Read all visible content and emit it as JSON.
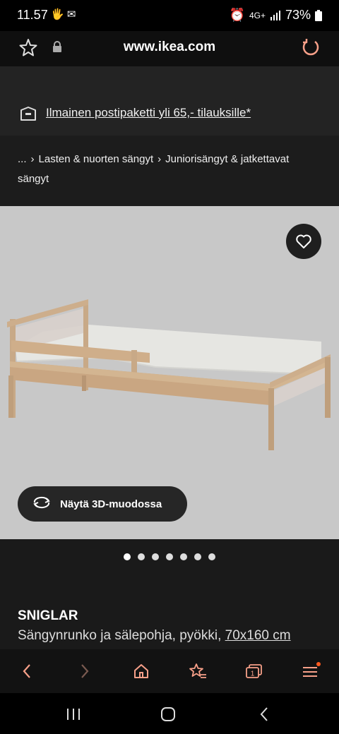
{
  "status_bar": {
    "time": "11.57",
    "network": "4G+",
    "battery": "73%"
  },
  "browser": {
    "url": "www.ikea.com"
  },
  "promo": {
    "text": "Ilmainen postipaketti yli 65,- tilauksille*"
  },
  "breadcrumb": {
    "ellipsis": "...",
    "items": [
      "Lasten & nuorten sängyt",
      "Juniorisängyt & jatkettavat sängyt"
    ]
  },
  "gallery": {
    "view_3d_label": "Näytä 3D-muodossa",
    "image_count": 7,
    "active_index": 0
  },
  "product": {
    "name": "SNIGLAR",
    "description": "Sängynrunko ja sälepohja, pyökki,",
    "size": "70x160 cm"
  },
  "colors": {
    "accent": "#f7a089",
    "notification_dot": "#ff5a1f"
  }
}
